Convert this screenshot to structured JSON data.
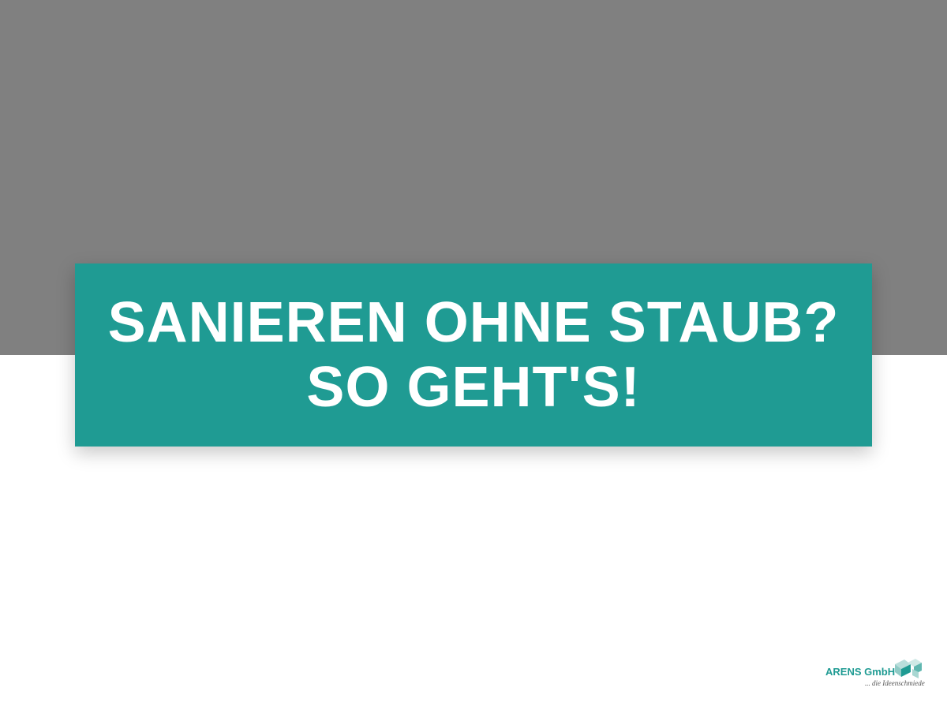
{
  "headline": {
    "line1": "SANIEREN OHNE STAUB?",
    "line2": "SO GEHT'S!"
  },
  "logo": {
    "name": "ARENS GmbH",
    "tagline": "... die Ideenschmiede"
  },
  "colors": {
    "top_band": "#808080",
    "headline_box": "#1f9b93",
    "headline_text": "#ffffff",
    "page_background": "#ffffff"
  }
}
